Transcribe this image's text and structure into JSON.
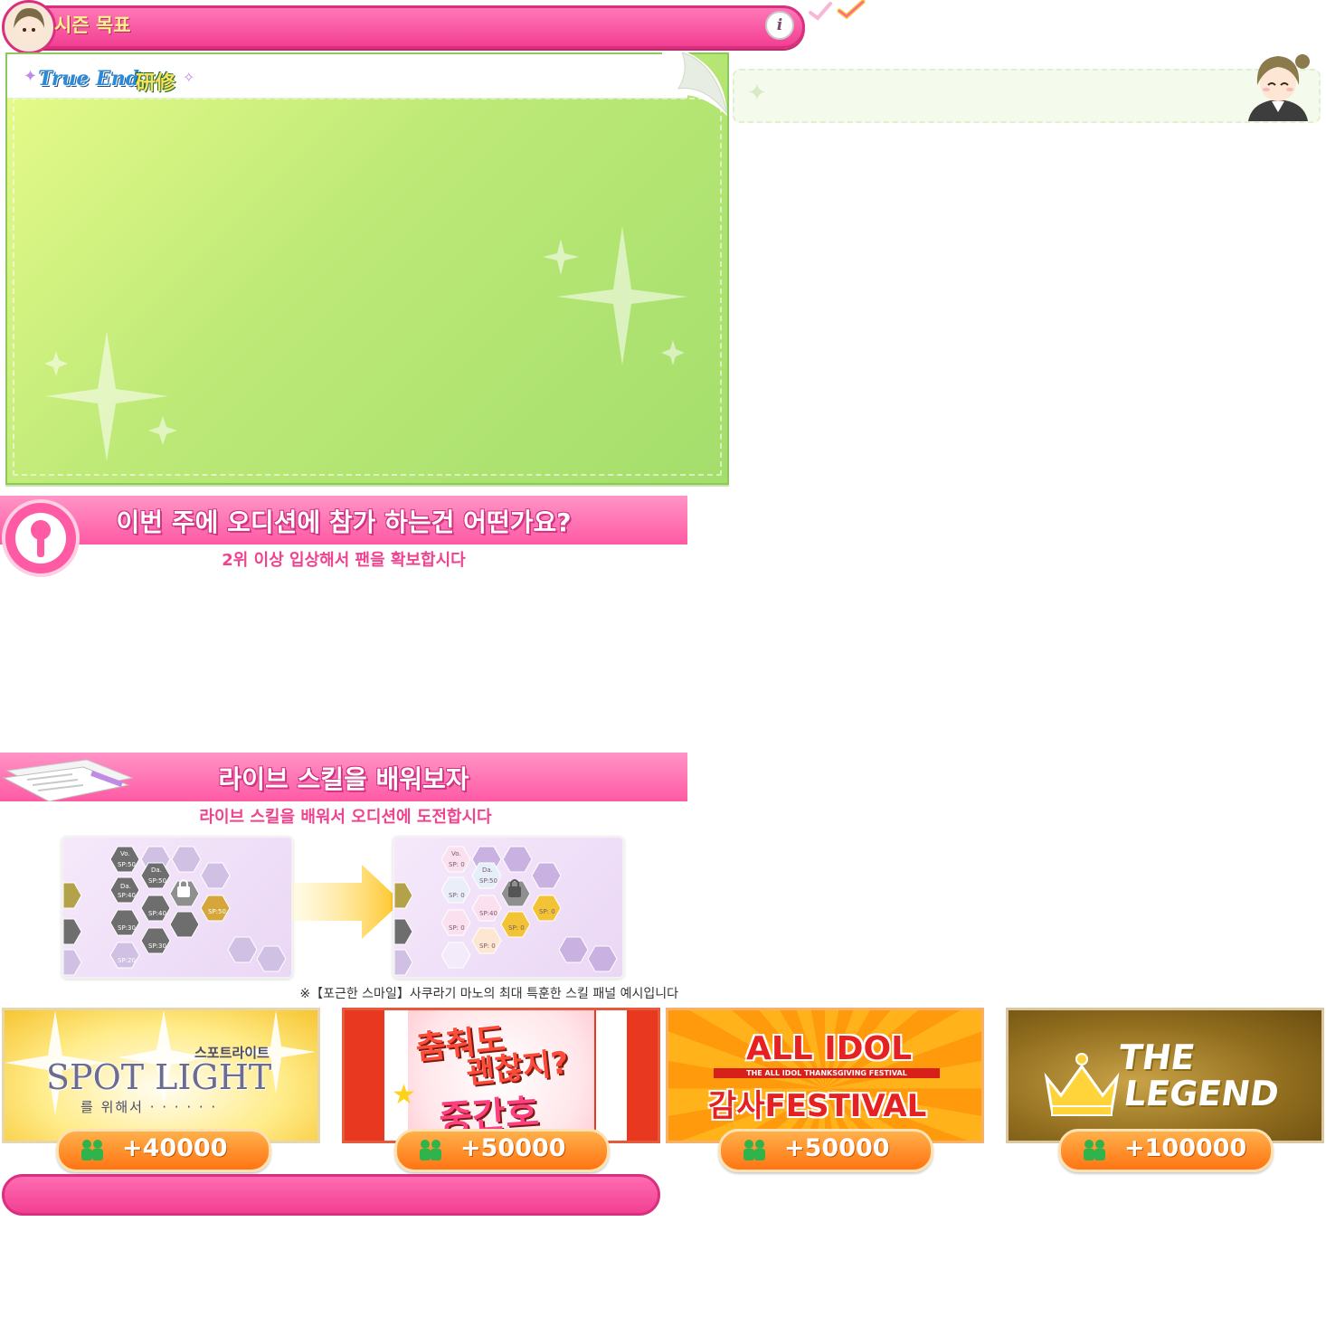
{
  "season": {
    "title": "시즌 목표",
    "info_label": "i"
  },
  "goal_panel": {
    "logo_text_en": "True End",
    "logo_text_kanji": "研修"
  },
  "section_audition": {
    "title": "이번 주에 오디션에 참가 하는건 어떤가요?",
    "subtitle": "2위 이상 입상해서 팬을 확보합시다"
  },
  "section_skill": {
    "title": "라이브 스킬을 배워보자",
    "subtitle": "라이브 스킬을 배워서 오디션에 도전합시다",
    "note": "※【포근한 스마일】사쿠라기 마노의 최대 특훈한 스킬 패널 예시입니다",
    "before_panel": [
      "Vo.",
      "Da.",
      "Da.",
      "SP:50",
      "SP:50",
      "SP:40",
      "SP:40",
      "SP:30",
      "SP:30",
      "SP:20",
      "SP:50"
    ],
    "after_panel": [
      "Vo.",
      "Da.",
      "SP: 0",
      "SP: 0",
      "SP:50",
      "SP: 0",
      "SP:40",
      "SP: 0",
      "SP: 0",
      "SP: 0"
    ]
  },
  "banners": [
    {
      "name": "spotlight",
      "title_line": "SPOT LIGHT",
      "kana": "스포트라이트",
      "sub": "를 위해서 · · · · · ·",
      "fans": "+40000"
    },
    {
      "name": "dance-ok",
      "title_line1": "춤춰도",
      "title_line2": "괜찮지?",
      "title_line3": "중간호",
      "fans": "+50000"
    },
    {
      "name": "all-idol",
      "title_line1": "ALL IDOL",
      "title_small": "THE ALL IDOL THANKSGIVING FESTIVAL",
      "title_line2": "감사FESTIVAL",
      "fans": "+50000"
    },
    {
      "name": "the-legend",
      "title_line1": "THE",
      "title_line2": "LEGEND",
      "fans": "+100000"
    }
  ],
  "colors": {
    "accent_pink": "#f23f93",
    "panel_green": "#bde977",
    "fan_orange": "#ff7413"
  }
}
